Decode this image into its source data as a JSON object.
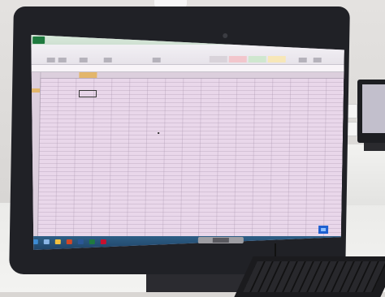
{
  "scene": {
    "description_colors": {
      "screen_tint": "#e9d7ea",
      "excel_green": "#1f7a3f",
      "selection_highlight": "#e3b66b",
      "monitor_bezel": "#202126",
      "taskbar": "#1f4468"
    }
  },
  "icons": {
    "webcam": "webcam-icon",
    "windows_sticker": "windows-logo-icon"
  }
}
